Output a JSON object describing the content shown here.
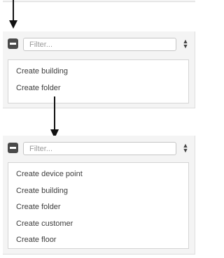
{
  "filter": {
    "placeholder": "Filter...",
    "sort_icon": "sort-up-down-icon",
    "collapse_icon": "minus-square-icon"
  },
  "panel_before": {
    "items": [
      {
        "label": "Create building"
      },
      {
        "label": "Create folder"
      }
    ]
  },
  "panel_after": {
    "items": [
      {
        "label": "Create device point"
      },
      {
        "label": "Create building"
      },
      {
        "label": "Create folder"
      },
      {
        "label": "Create customer"
      },
      {
        "label": "Create floor"
      }
    ]
  },
  "colors": {
    "panel_bg": "#f4f4f4",
    "button": "#4a4a4a",
    "border": "#d4d4d4"
  }
}
